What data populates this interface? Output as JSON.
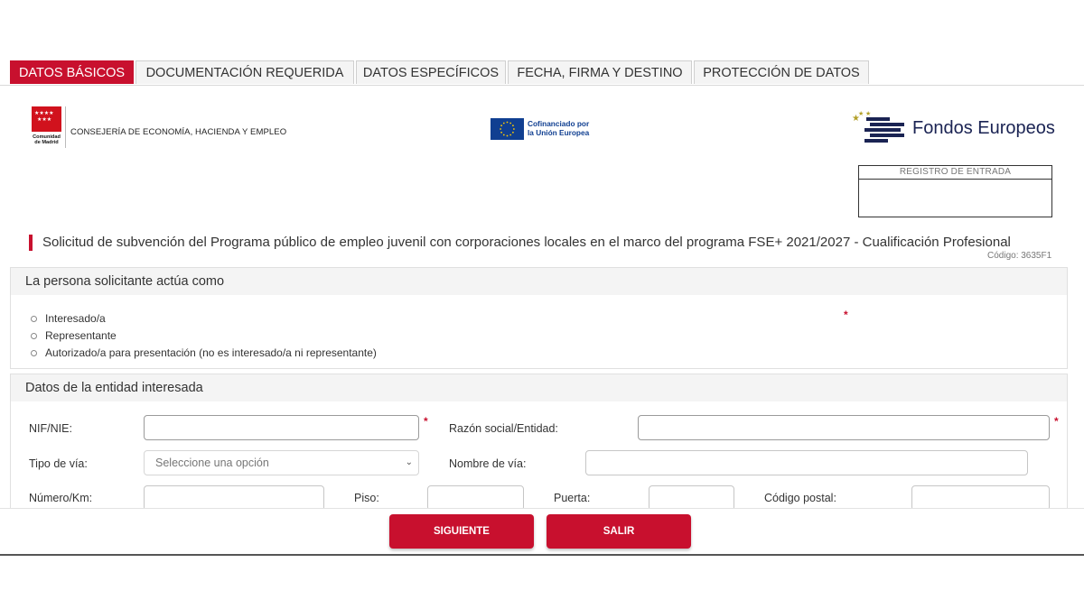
{
  "tabs": [
    {
      "label": "DATOS BÁSICOS",
      "active": true
    },
    {
      "label": "DOCUMENTACIÓN REQUERIDA",
      "active": false
    },
    {
      "label": "DATOS ESPECÍFICOS",
      "active": false
    },
    {
      "label": "FECHA, FIRMA Y DESTINO",
      "active": false
    },
    {
      "label": "PROTECCIÓN DE DATOS",
      "active": false
    }
  ],
  "header": {
    "comunidad_logo_text": "Comunidad de Madrid",
    "consejeria": "CONSEJERÍA DE ECONOMÍA, HACIENDA Y EMPLEO",
    "eu_text_line1": "Cofinanciado por",
    "eu_text_line2": "la Unión Europea",
    "fondos": "Fondos Europeos",
    "registro_label": "REGISTRO DE ENTRADA"
  },
  "form": {
    "title": "Solicitud de subvención del Programa público de empleo juvenil con corporaciones locales en el marco del programa FSE+ 2021/2027 - Cualificación Profesional",
    "codigo": "Código: 3635F1"
  },
  "solicitante": {
    "heading": "La persona solicitante actúa como",
    "required_mark": "*",
    "options": [
      "Interesado/a",
      "Representante",
      "Autorizado/a para presentación (no es interesado/a ni representante)"
    ]
  },
  "entidad": {
    "heading": "Datos de la entidad interesada",
    "required_mark": "*",
    "nif_label": "NIF/NIE:",
    "nif_value": "",
    "razon_label": "Razón social/Entidad:",
    "razon_value": "",
    "tipo_via_label": "Tipo de vía:",
    "tipo_via_selected": "Seleccione una opción",
    "nombre_via_label": "Nombre de vía:",
    "numero_label": "Número/Km:",
    "piso_label": "Piso:",
    "puerta_label": "Puerta:",
    "cp_label": "Código postal:"
  },
  "actions": {
    "next_label": "SIGUIENTE",
    "exit_label": "SALIR"
  },
  "colors": {
    "accent": "#c8102e",
    "eu_blue": "#103f91",
    "fondos_navy": "#1a2353"
  },
  "icons": {
    "tipo_via_dropdown": "chevron-down-icon"
  }
}
